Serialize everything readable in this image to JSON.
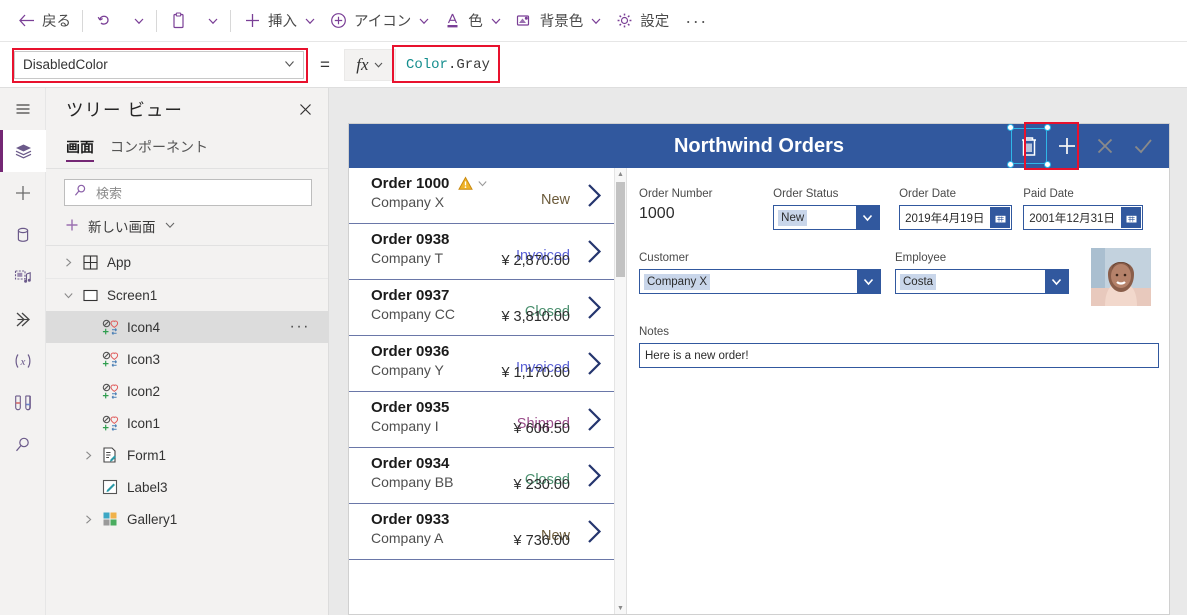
{
  "toolbar": {
    "items": [
      {
        "name": "back",
        "icon": "arrow-left-icon",
        "label": "戻る",
        "chevron": false
      },
      {
        "name": "undo",
        "icon": "undo-icon",
        "label": "",
        "chevron": false
      },
      {
        "name": "undo-more",
        "icon": "",
        "label": "",
        "chevron": true
      },
      {
        "name": "paste",
        "icon": "clipboard-icon",
        "label": "",
        "chevron": false
      },
      {
        "name": "paste-more",
        "icon": "",
        "label": "",
        "chevron": true
      },
      {
        "name": "insert",
        "icon": "plus-icon",
        "label": "挿入",
        "chevron": true
      },
      {
        "name": "icons",
        "icon": "circle-plus-icon",
        "label": "アイコン",
        "chevron": true
      },
      {
        "name": "color",
        "icon": "font-color-icon",
        "label": "色",
        "chevron": true
      },
      {
        "name": "background-color",
        "icon": "background-color-icon",
        "label": "背景色",
        "chevron": true
      },
      {
        "name": "settings",
        "icon": "gear-icon",
        "label": "設定",
        "chevron": false
      }
    ],
    "overflow_label": "···"
  },
  "formula_bar": {
    "property_value": "DisabledColor",
    "equals": "=",
    "fx_label": "fx",
    "formula_namespace": "Color",
    "formula_member": ".Gray",
    "highlight_color": "#e8112d"
  },
  "rail": {
    "items": [
      {
        "name": "hamburger-menu-icon",
        "active": false
      },
      {
        "name": "tree-view-layers-icon",
        "active": true
      },
      {
        "name": "insert-plus-icon",
        "active": false
      },
      {
        "name": "data-cylinder-icon",
        "active": false
      },
      {
        "name": "media-icon",
        "active": false
      },
      {
        "name": "power-automate-icon",
        "active": false
      },
      {
        "name": "variables-icon",
        "active": false
      },
      {
        "name": "test-tubes-icon",
        "active": false
      },
      {
        "name": "search-icon",
        "active": false
      }
    ]
  },
  "treeview": {
    "title": "ツリー ビュー",
    "close_label": "✕",
    "tabs": [
      {
        "label": "画面",
        "active": true
      },
      {
        "label": "コンポーネント",
        "active": false
      }
    ],
    "search_placeholder": "検索",
    "new_screen_label": "新しい画面",
    "nodes": [
      {
        "label": "App",
        "level": 0,
        "chevron": "right",
        "icon": "app-grid-icon",
        "selected": false,
        "dots": false
      },
      {
        "label": "Screen1",
        "level": 0,
        "chevron": "down",
        "icon": "screen-icon",
        "selected": false,
        "dots": false
      },
      {
        "label": "Icon4",
        "level": 1,
        "chevron": "none",
        "icon": "icon-control-icon",
        "selected": true,
        "dots": true
      },
      {
        "label": "Icon3",
        "level": 1,
        "chevron": "none",
        "icon": "icon-control-icon",
        "selected": false,
        "dots": false
      },
      {
        "label": "Icon2",
        "level": 1,
        "chevron": "none",
        "icon": "icon-control-icon",
        "selected": false,
        "dots": false
      },
      {
        "label": "Icon1",
        "level": 1,
        "chevron": "none",
        "icon": "icon-control-icon",
        "selected": false,
        "dots": false
      },
      {
        "label": "Form1",
        "level": 1,
        "chevron": "right",
        "icon": "form-icon",
        "selected": false,
        "dots": false
      },
      {
        "label": "Label3",
        "level": 1,
        "chevron": "none",
        "icon": "label-icon",
        "selected": false,
        "dots": false
      },
      {
        "label": "Gallery1",
        "level": 1,
        "chevron": "right",
        "icon": "gallery-icon",
        "selected": false,
        "dots": false
      }
    ]
  },
  "app": {
    "header": {
      "title": "Northwind Orders",
      "background": "#31589e",
      "icons": [
        {
          "name": "trash-icon",
          "state": "selected"
        },
        {
          "name": "plus-icon",
          "state": "normal"
        },
        {
          "name": "cancel-x-icon",
          "state": "disabled"
        },
        {
          "name": "checkmark-icon",
          "state": "disabled"
        }
      ]
    },
    "gallery": {
      "rows": [
        {
          "order": "Order 1000",
          "company": "Company X",
          "status": "New",
          "amount": "",
          "warning": true
        },
        {
          "order": "Order 0938",
          "company": "Company T",
          "status": "Invoiced",
          "amount": "¥ 2,870.00",
          "warning": false
        },
        {
          "order": "Order 0937",
          "company": "Company CC",
          "status": "Closed",
          "amount": "¥ 3,810.00",
          "warning": false
        },
        {
          "order": "Order 0936",
          "company": "Company Y",
          "status": "Invoiced",
          "amount": "¥ 1,170.00",
          "warning": false
        },
        {
          "order": "Order 0935",
          "company": "Company I",
          "status": "Shipped",
          "amount": "¥ 606.50",
          "warning": false
        },
        {
          "order": "Order 0934",
          "company": "Company BB",
          "status": "Closed",
          "amount": "¥ 230.00",
          "warning": false
        },
        {
          "order": "Order 0933",
          "company": "Company A",
          "status": "New",
          "amount": "¥ 736.00",
          "warning": false
        }
      ]
    },
    "form": {
      "order_number_label": "Order Number",
      "order_number_value": "1000",
      "order_status_label": "Order Status",
      "order_status_value": "New",
      "order_date_label": "Order Date",
      "order_date_value": "2019年4月19日",
      "paid_date_label": "Paid Date",
      "paid_date_value": "2001年12月31日",
      "customer_label": "Customer",
      "customer_value": "Company X",
      "employee_label": "Employee",
      "employee_value": "Costa",
      "notes_label": "Notes",
      "notes_value": "Here is a new order!"
    }
  }
}
